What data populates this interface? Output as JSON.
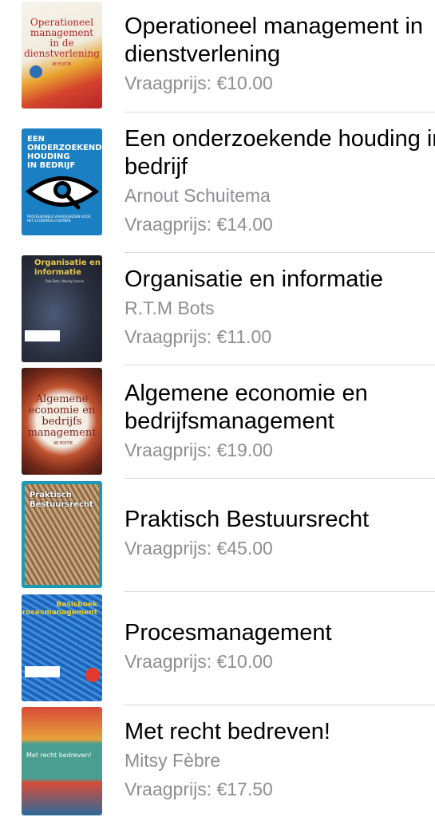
{
  "books": [
    {
      "title_line1": "Operationeel management in",
      "title_line2": "dienstverlening",
      "author": "",
      "price": "Vraagprijs: €10.00",
      "cover": {
        "t1": "Operationeel",
        "t2": "management",
        "t3": "in de",
        "t4": "dienstverlening",
        "edition": "4E EDITIE"
      }
    },
    {
      "title_line1": "Een onderzoekende houding in",
      "title_line2": "bedrijf",
      "author": "Arnout Schuitema",
      "price": "Vraagprijs: €14.00",
      "cover": {
        "t1": "EEN",
        "t2": "ONDERZOEKENDE",
        "t3": "HOUDING",
        "t4": "IN BEDRIJF",
        "sub": "PROFESSIONELE VAARDIGHEDEN VOOR HET ECONOMISCH DOMEIN"
      }
    },
    {
      "title_line1": "Organisatie en informatie",
      "title_line2": "",
      "author": "R.T.M Bots",
      "price": "Vraagprijs: €11.00",
      "cover": {
        "t1": "Organisatie en",
        "t2": "informatie",
        "authors": "Rob Bots, Wendy Jansen"
      }
    },
    {
      "title_line1": "Algemene economie en",
      "title_line2": "bedrijfsmanagement",
      "author": "",
      "price": "Vraagprijs: €19.00",
      "cover": {
        "t1": "Algemene",
        "t2": "economie en",
        "t3": "bedrijfs",
        "t4": "management",
        "edition": "4E EDITIE"
      }
    },
    {
      "title_line1": "Praktisch Bestuursrecht",
      "title_line2": "",
      "author": "",
      "price": "Vraagprijs: €45.00",
      "cover": {
        "t1": "Praktisch",
        "t2": "Bestuursrecht"
      }
    },
    {
      "title_line1": "Procesmanagement",
      "title_line2": "",
      "author": "",
      "price": "Vraagprijs: €10.00",
      "cover": {
        "t1": "Basisboek",
        "t2": "Procesmanagement"
      }
    },
    {
      "title_line1": "Met recht bedreven!",
      "title_line2": "",
      "author": "Mitsy Fèbre",
      "price": "Vraagprijs: €17.50",
      "cover": {
        "t1": "Met recht bedreven!"
      }
    }
  ]
}
